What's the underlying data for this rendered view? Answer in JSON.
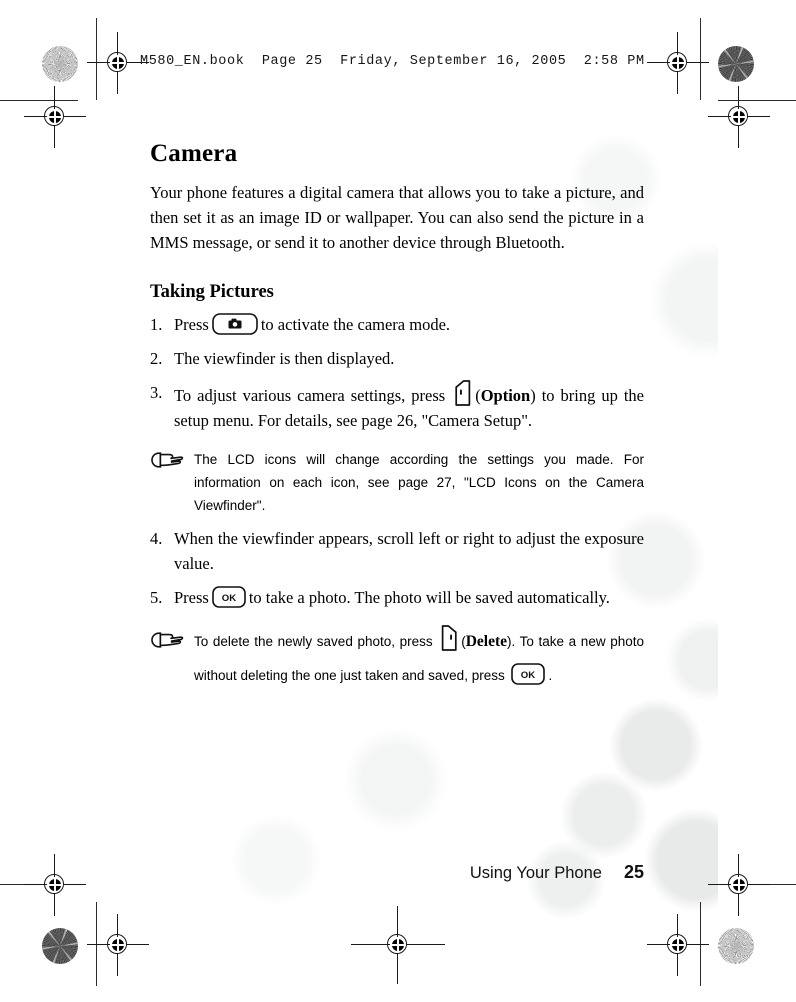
{
  "header": {
    "file_line": "M580_EN.book  Page 25  Friday, September 16, 2005  2:58 PM"
  },
  "content": {
    "chapter_title": "Camera",
    "intro": "Your phone features a digital camera that allows you to take a picture, and then set it as an image ID or wallpaper. You can also send the picture in a MMS message, or send it to another device through Bluetooth.",
    "section_title": "Taking Pictures",
    "steps": [
      {
        "number": "1.",
        "text_before": "Press",
        "key": "camera-key",
        "text_after": "to activate the camera mode."
      },
      {
        "number": "2.",
        "text_before": "The viewfinder is then displayed.",
        "key": null,
        "text_after": ""
      },
      {
        "number": "3.",
        "text_before": "To adjust various camera settings, press",
        "key": "left-soft-key",
        "key_label": "Option",
        "text_after": ") to bring up the setup menu. For details, see page 26, \"Camera Setup\"."
      },
      {
        "number": "4.",
        "text_before": "When the viewfinder appears, scroll left or right to adjust the exposure value.",
        "key": null,
        "text_after": ""
      },
      {
        "number": "5.",
        "text_before": "Press",
        "key": "ok-key",
        "text_after": "to take a photo. The photo will be saved automatically."
      }
    ],
    "note_one": {
      "text": "The LCD icons will change according the settings you made. For information on each icon, see page 27, \"LCD Icons on the Camera Viewfinder\"."
    },
    "note_two": {
      "text_before": "To delete the newly saved photo, press",
      "key_label": "Delete",
      "text_middle": "). To take a new photo without deleting the one just taken and saved, press",
      "text_after": "."
    }
  },
  "footer": {
    "section_label": "Using Your Phone",
    "page_number": "25"
  },
  "keys": {
    "ok_label": "OK"
  },
  "marks": {
    "paren_open": "(",
    "paren_close": ")"
  },
  "colors": {
    "ink": "#000000",
    "page": "#ffffff",
    "mark": "#1a1a1a"
  }
}
